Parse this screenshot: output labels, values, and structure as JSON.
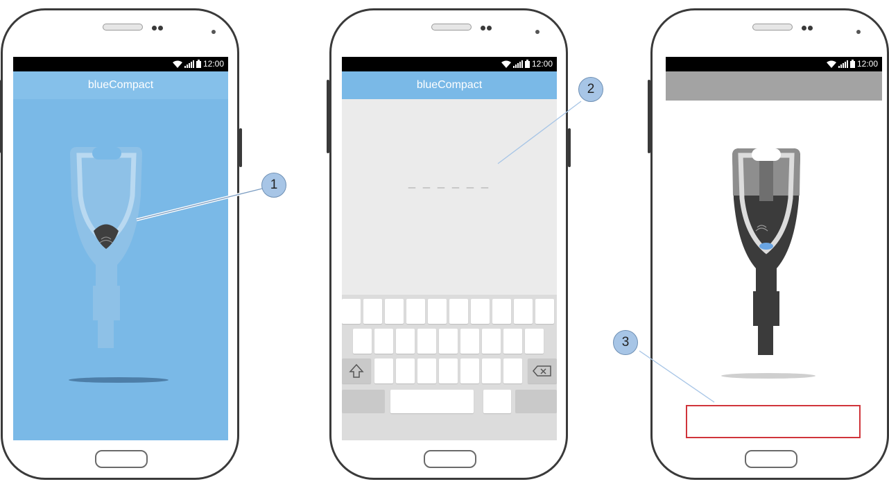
{
  "status_bar": {
    "time": "12:00"
  },
  "screens": [
    {
      "app_title": "blueCompact",
      "screen_color": "#7ab9e7"
    },
    {
      "app_title": "blueCompact",
      "appbar_color": "#7ab9e7",
      "code_placeholder": "_ _ _ _ _ _"
    },
    {
      "app_title": "",
      "appbar_color": "#a3a3a3"
    }
  ],
  "callouts": [
    {
      "label": "1"
    },
    {
      "label": "2"
    },
    {
      "label": "3"
    }
  ],
  "colors": {
    "callout_fill": "#a7c5e6",
    "highlight_box": "#d0343a",
    "phone_outline": "#3a3a3a"
  }
}
